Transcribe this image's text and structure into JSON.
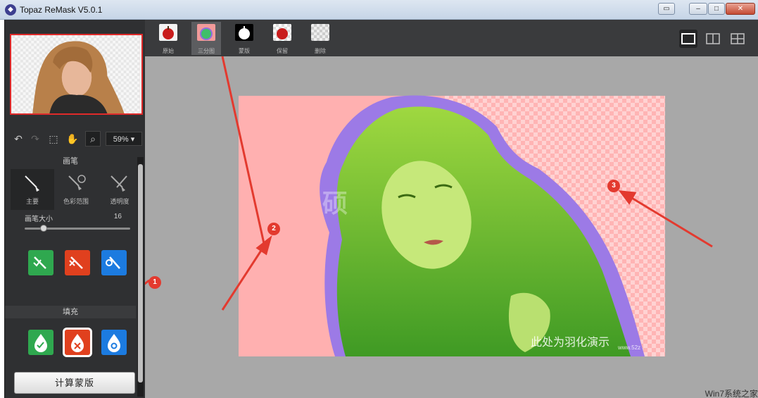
{
  "window": {
    "title": "Topaz ReMask V5.0.1",
    "logo_icon": "topaz-logo-icon",
    "controls": [
      "restore-down-icon",
      "minimize-icon",
      "maximize-icon",
      "close-icon"
    ]
  },
  "toolbar": {
    "zoom": "59%",
    "tools": [
      "undo-icon",
      "redo-icon",
      "marquee-select-icon",
      "hand-pan-icon",
      "zoom-icon"
    ]
  },
  "brush": {
    "section_title": "画笔",
    "tabs": [
      {
        "label": "主要",
        "icon": "brush-icon",
        "active": true
      },
      {
        "label": "色彩范围",
        "icon": "color-range-brush-icon",
        "active": false
      },
      {
        "label": "透明度",
        "icon": "transparency-brush-icon",
        "active": false
      }
    ],
    "size_label": "画笔大小",
    "size_value": "16",
    "size_level": 0.16,
    "modes": [
      {
        "icon": "keep-brush-icon",
        "color": "#2fa84f"
      },
      {
        "icon": "cut-brush-icon",
        "color": "#e0401e"
      },
      {
        "icon": "compute-brush-icon",
        "color": "#1c7be0"
      }
    ]
  },
  "fill": {
    "section_title": "填充",
    "modes": [
      {
        "icon": "keep-fill-icon",
        "color": "#2fa84f",
        "selected": false
      },
      {
        "icon": "cut-fill-icon",
        "color": "#e0401e",
        "selected": true
      },
      {
        "icon": "compute-fill-icon",
        "color": "#1c7be0",
        "selected": false
      }
    ]
  },
  "compute_button": "计算蒙版",
  "view_tabs": [
    {
      "label": "原始",
      "icon": "original-view-icon",
      "active": false
    },
    {
      "label": "三分图",
      "icon": "trimap-view-icon",
      "active": true
    },
    {
      "label": "蒙版",
      "icon": "mask-view-icon",
      "active": false
    },
    {
      "label": "保留",
      "icon": "keep-view-icon",
      "active": false
    },
    {
      "label": "删除",
      "icon": "delete-view-icon",
      "active": false
    }
  ],
  "layout_buttons": [
    "single-view-icon",
    "split-view-icon",
    "quad-view-icon"
  ],
  "annotations": [
    {
      "label": "1"
    },
    {
      "label": "2"
    },
    {
      "label": "3"
    }
  ],
  "watermarks": {
    "center": "硕",
    "bottom": "此处为羽化演示",
    "url": "www.52z"
  },
  "colors": {
    "cut_region": "#ffaaaa",
    "keep_region": "#8fd13a",
    "compute_region": "#8f6ee0",
    "annotation_red": "#e33a2f"
  },
  "brand_corner": "Win7系统之家"
}
